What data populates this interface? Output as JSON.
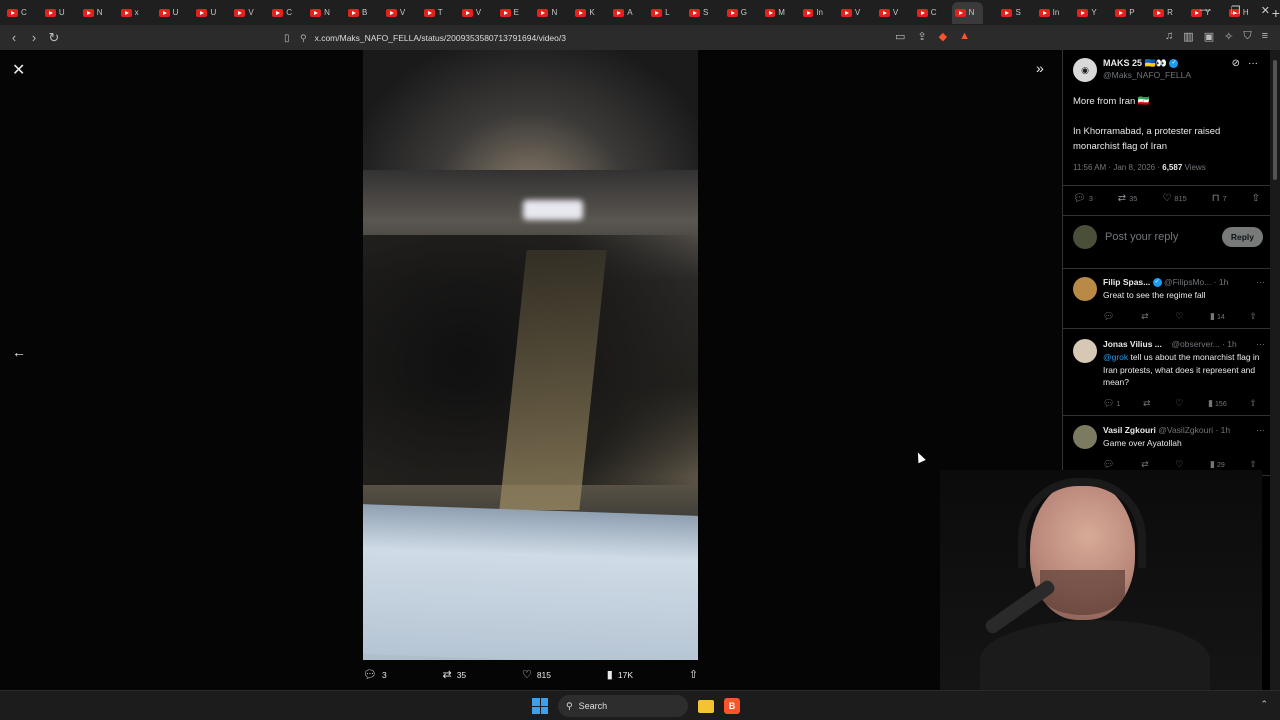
{
  "browser": {
    "url": "x.com/Maks_NAFO_FELLA/status/2009353580713791694/video/3",
    "tabs": [
      "C",
      "U",
      "N",
      "x",
      "U",
      "U",
      "V",
      "C",
      "N",
      "B",
      "V",
      "T",
      "V",
      "E",
      "N",
      "K",
      "A",
      "L",
      "S",
      "G",
      "M",
      "In",
      "V",
      "V",
      "C",
      "N",
      "S",
      "In",
      "Y",
      "P",
      "R",
      "Y",
      "H"
    ],
    "active_tab_index": 25
  },
  "video_actions": {
    "replies": "3",
    "reposts": "35",
    "likes": "815",
    "views": "17K"
  },
  "tweet": {
    "author_name": "MAKS 25 🇺🇦👀",
    "author_handle": "@Maks_NAFO_FELLA",
    "line1": "More from Iran 🇮🇷",
    "line2": "In Khorramabad, a protester raised monarchist flag of Iran",
    "time": "11:56 AM · Jan 8, 2026 · ",
    "views": "6,587",
    "views_label": " Views",
    "stats": {
      "replies": "3",
      "reposts": "35",
      "likes": "815",
      "bookmarks": "7"
    }
  },
  "reply_box": {
    "placeholder": "Post your reply",
    "button": "Reply"
  },
  "replies": [
    {
      "name": "Filip Spas...",
      "handle": "@FilipsMo...",
      "time": "· 1h",
      "text": "Great to see the regime fall",
      "mention": "",
      "replies": "",
      "views": "14",
      "avatar_color": "#b98a45"
    },
    {
      "name": "Jonas Vilius ...",
      "handle": "@observer...",
      "time": "· 1h",
      "mention": "@grok",
      "text": " tell us about the monarchist flag in Iran protests, what does it represent and mean?",
      "replies": "1",
      "views": "156",
      "avatar_color": "#d7c7b5"
    },
    {
      "name": "Vasil Zgkouri",
      "handle": "@VasilZgkouri",
      "time": "· 1h",
      "text": "Game over Ayatollah",
      "mention": "",
      "replies": "",
      "views": "29",
      "avatar_color": "#7c7a60"
    }
  ],
  "taskbar": {
    "search": "Search"
  }
}
